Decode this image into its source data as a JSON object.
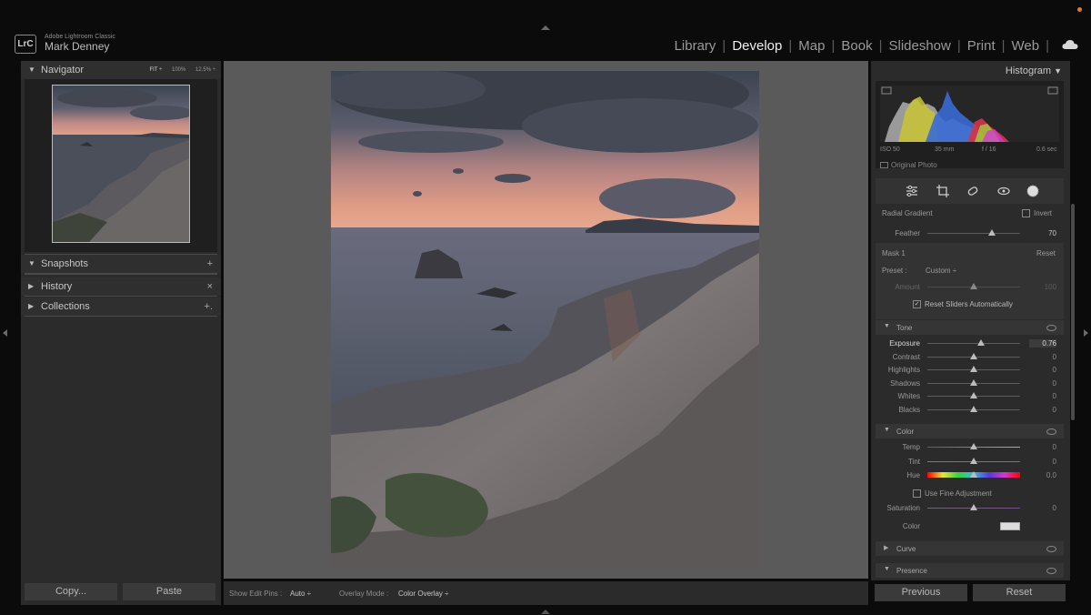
{
  "app": {
    "product_name": "Adobe Lightroom Classic",
    "logo_text": "LrC",
    "user_name": "Mark Denney"
  },
  "modules": [
    {
      "label": "Library",
      "active": false
    },
    {
      "label": "Develop",
      "active": true
    },
    {
      "label": "Map",
      "active": false
    },
    {
      "label": "Book",
      "active": false
    },
    {
      "label": "Slideshow",
      "active": false
    },
    {
      "label": "Print",
      "active": false
    },
    {
      "label": "Web",
      "active": false
    }
  ],
  "left_panel": {
    "navigator": {
      "title": "Navigator",
      "zoom_options": [
        "FIT ÷",
        "100%",
        "12.5% ÷"
      ]
    },
    "snapshots": {
      "title": "Snapshots",
      "action": "+"
    },
    "history": {
      "title": "History",
      "action": "×"
    },
    "collections": {
      "title": "Collections",
      "action": "+."
    },
    "copy_label": "Copy...",
    "paste_label": "Paste"
  },
  "toolbar": {
    "show_edit_pins_label": "Show Edit Pins :",
    "show_edit_pins_value": "Auto ÷",
    "overlay_mode_label": "Overlay Mode :",
    "overlay_mode_value": "Color Overlay ÷"
  },
  "right_panel": {
    "histogram_title": "Histogram",
    "exif": {
      "iso": "ISO 50",
      "focal": "35 mm",
      "aperture": "f / 16",
      "shutter": "0.6 sec"
    },
    "original_photo": "Original Photo",
    "mask_type": "Radial Gradient",
    "invert_label": "Invert",
    "feather": {
      "label": "Feather",
      "value": "70",
      "position": 0.7
    },
    "mask_name": "Mask 1",
    "mask_reset": "Reset",
    "preset_label": "Preset :",
    "preset_value": "Custom ÷",
    "amount": {
      "label": "Amount",
      "value": "100",
      "position": 0.5
    },
    "reset_sliders_label": "Reset Sliders Automatically",
    "tone": {
      "title": "Tone",
      "sliders": [
        {
          "label": "Exposure",
          "value": "0.76",
          "position": 0.58
        },
        {
          "label": "Contrast",
          "value": "0",
          "position": 0.5
        },
        {
          "label": "Highlights",
          "value": "0",
          "position": 0.5
        },
        {
          "label": "Shadows",
          "value": "0",
          "position": 0.5
        },
        {
          "label": "Whites",
          "value": "0",
          "position": 0.5
        },
        {
          "label": "Blacks",
          "value": "0",
          "position": 0.5
        }
      ]
    },
    "color": {
      "title": "Color",
      "sliders": [
        {
          "label": "Temp",
          "value": "0",
          "position": 0.5
        },
        {
          "label": "Tint",
          "value": "0",
          "position": 0.5
        },
        {
          "label": "Hue",
          "value": "0.0",
          "position": 0.5
        }
      ],
      "fine_adjust_label": "Use Fine Adjustment",
      "saturation": {
        "label": "Saturation",
        "value": "0",
        "position": 0.5
      },
      "color_label": "Color"
    },
    "curve_title": "Curve",
    "presence_title": "Presence",
    "previous_label": "Previous",
    "reset_label": "Reset"
  },
  "colors": {
    "bg": "#0b0b0b",
    "panel": "#2b2b2b",
    "center_bg": "#5a5a5a",
    "accent_dot": "#e07b2a"
  }
}
